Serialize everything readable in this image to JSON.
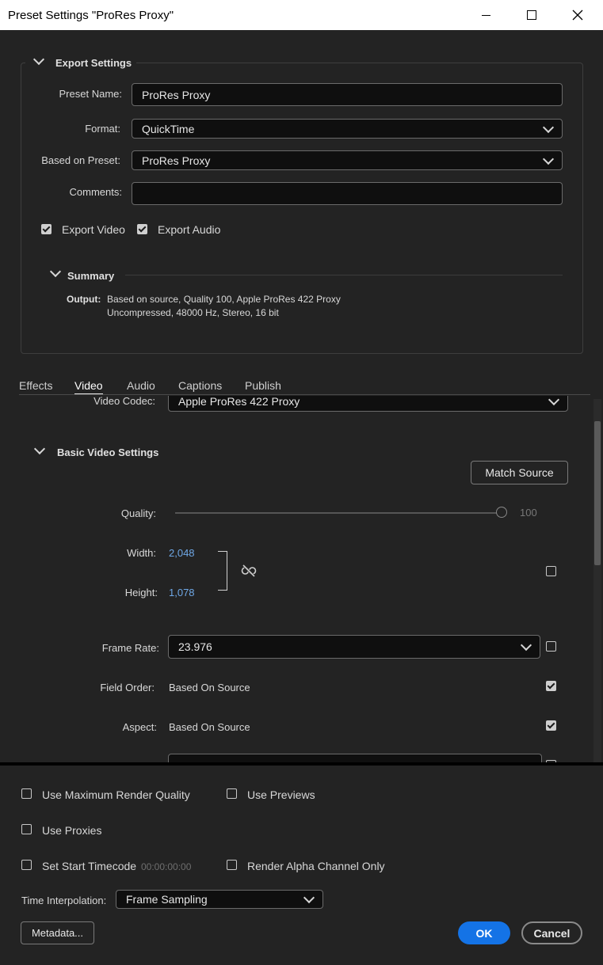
{
  "window": {
    "title": "Preset Settings \"ProRes Proxy\"",
    "minimize_icon": "minimize-icon",
    "maximize_icon": "maximize-icon",
    "close_icon": "close-icon"
  },
  "export_settings": {
    "heading": "Export Settings",
    "preset_name_label": "Preset Name:",
    "preset_name_value": "ProRes Proxy",
    "format_label": "Format:",
    "format_value": "QuickTime",
    "based_on_preset_label": "Based on Preset:",
    "based_on_preset_value": "ProRes Proxy",
    "comments_label": "Comments:",
    "comments_value": "",
    "export_video_label": "Export Video",
    "export_video_checked": true,
    "export_audio_label": "Export Audio",
    "export_audio_checked": true
  },
  "summary": {
    "heading": "Summary",
    "output_label": "Output:",
    "output_line1": "Based on source, Quality 100, Apple ProRes 422 Proxy",
    "output_line2": "Uncompressed, 48000 Hz, Stereo, 16 bit"
  },
  "tabs": [
    {
      "label": "Effects",
      "active": false
    },
    {
      "label": "Video",
      "active": true
    },
    {
      "label": "Audio",
      "active": false
    },
    {
      "label": "Captions",
      "active": false
    },
    {
      "label": "Publish",
      "active": false
    }
  ],
  "video": {
    "codec_label": "Video Codec:",
    "codec_value": "Apple ProRes 422 Proxy",
    "basic_heading": "Basic Video Settings",
    "match_source_label": "Match Source",
    "quality_label": "Quality:",
    "quality_value": "100",
    "quality_fraction": 1.0,
    "width_label": "Width:",
    "width_value": "2,048",
    "height_label": "Height:",
    "height_value": "1,078",
    "width_height_checked": false,
    "frame_rate_label": "Frame Rate:",
    "frame_rate_value": "23.976",
    "frame_rate_checked": false,
    "field_order_label": "Field Order:",
    "field_order_value": "Based On Source",
    "field_order_checked": true,
    "aspect_label": "Aspect:",
    "aspect_value": "Based On Source",
    "aspect_checked": true
  },
  "render_options": {
    "max_render_quality_label": "Use Maximum Render Quality",
    "max_render_quality_checked": false,
    "use_previews_label": "Use Previews",
    "use_previews_checked": false,
    "use_proxies_label": "Use Proxies",
    "use_proxies_checked": false,
    "set_start_timecode_label": "Set Start Timecode",
    "set_start_timecode_checked": false,
    "start_timecode_value": "00:00:00:00",
    "render_alpha_label": "Render Alpha Channel Only",
    "render_alpha_checked": false,
    "time_interpolation_label": "Time Interpolation:",
    "time_interpolation_value": "Frame Sampling"
  },
  "footer": {
    "metadata_label": "Metadata...",
    "ok_label": "OK",
    "cancel_label": "Cancel"
  },
  "colors": {
    "accent": "#1473e6",
    "link_value": "#6fa8e6",
    "background": "#232323"
  }
}
